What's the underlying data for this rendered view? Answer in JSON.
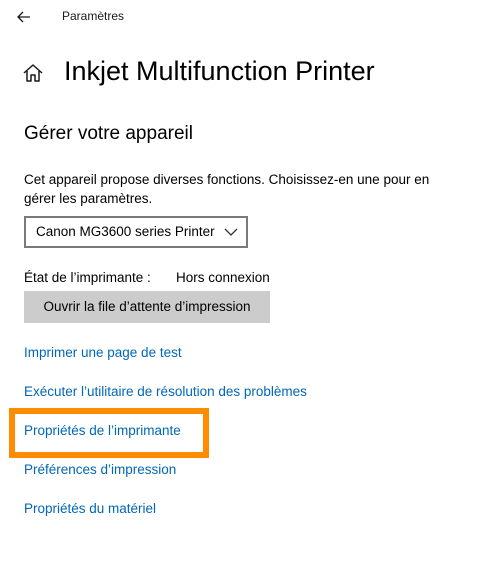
{
  "header": {
    "back_icon": "arrow-left-icon",
    "app_title": "Paramètres"
  },
  "page": {
    "home_icon": "home-icon",
    "title": "Inkjet Multifunction Printer"
  },
  "manage": {
    "section_title": "Gérer votre appareil",
    "description": "Cet appareil propose diverses fonctions. Choisissez-en une pour en gérer les paramètres.",
    "device_select": {
      "selected": "Canon MG3600 series Printer",
      "chevron_icon": "chevron-down-icon"
    },
    "status_label": "État de l’imprimante :",
    "status_value": "Hors connexion",
    "queue_button_label": "Ouvrir la file d’attente d’impression"
  },
  "links": [
    {
      "label": "Imprimer une page de test"
    },
    {
      "label": "Exécuter l’utilitaire de résolution des problèmes"
    },
    {
      "label": "Propriétés de l’imprimante",
      "highlighted": true
    },
    {
      "label": "Préférences d’impression"
    },
    {
      "label": "Propriétés du matériel"
    }
  ],
  "colors": {
    "link": "#0067b8",
    "button_bg": "#cccccc",
    "highlight": "#ff8c00"
  }
}
